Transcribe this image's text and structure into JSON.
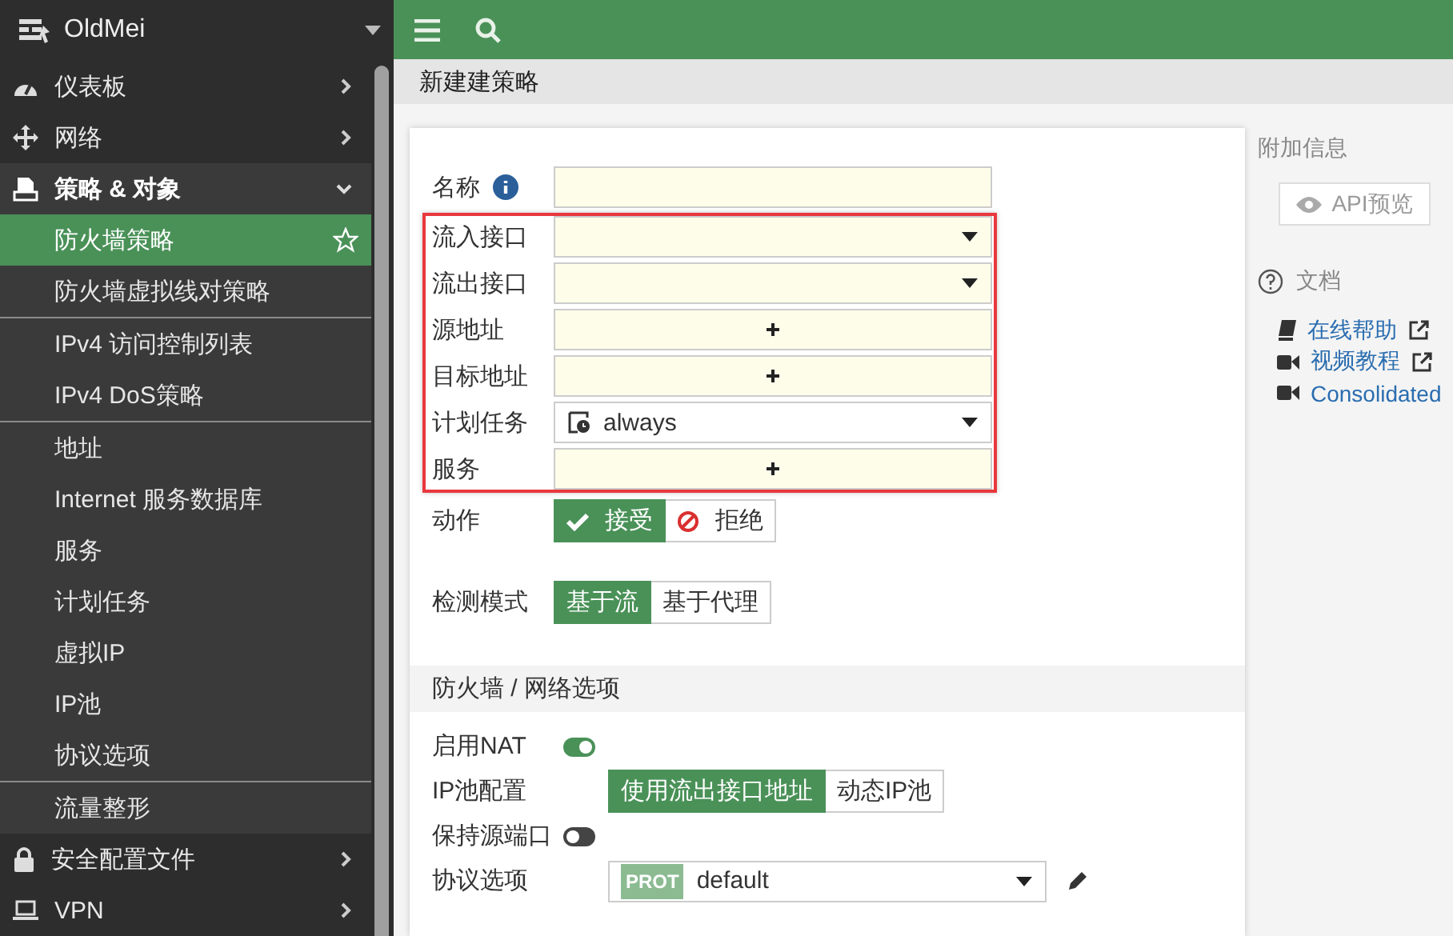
{
  "brand": {
    "name": "OldMei"
  },
  "sidebar": {
    "items": [
      {
        "label": "仪表板",
        "expanded": false
      },
      {
        "label": "网络",
        "expanded": false
      },
      {
        "label": "策略 & 对象",
        "expanded": true,
        "groups": [
          [
            {
              "label": "防火墙策略",
              "selected": true
            },
            {
              "label": "防火墙虚拟线对策略",
              "selected": false
            }
          ],
          [
            {
              "label": "IPv4 访问控制列表",
              "selected": false
            },
            {
              "label": "IPv4 DoS策略",
              "selected": false
            }
          ],
          [
            {
              "label": "地址",
              "selected": false
            },
            {
              "label": "Internet 服务数据库",
              "selected": false
            },
            {
              "label": "服务",
              "selected": false
            },
            {
              "label": "计划任务",
              "selected": false
            },
            {
              "label": "虚拟IP",
              "selected": false
            },
            {
              "label": "IP池",
              "selected": false
            },
            {
              "label": "协议选项",
              "selected": false
            }
          ],
          [
            {
              "label": "流量整形",
              "selected": false
            }
          ]
        ]
      },
      {
        "label": "安全配置文件",
        "expanded": false
      },
      {
        "label": "VPN",
        "expanded": false
      }
    ]
  },
  "breadcrumb": "新建建策略",
  "form": {
    "groups": [
      {
        "highlighted": false,
        "fields": [
          {
            "label": "名称",
            "kind": "text",
            "info": true
          }
        ]
      },
      {
        "highlighted": true,
        "fields": [
          {
            "label": "流入接口",
            "kind": "select",
            "info": false
          },
          {
            "label": "流出接口",
            "kind": "select",
            "info": false
          },
          {
            "label": "源地址",
            "kind": "add",
            "info": false
          },
          {
            "label": "目标地址",
            "kind": "add",
            "info": false
          },
          {
            "label": "计划任务",
            "kind": "schedule",
            "value": "always",
            "info": false
          },
          {
            "label": "服务",
            "kind": "add",
            "info": false
          }
        ]
      }
    ],
    "action": {
      "label": "动作",
      "options": [
        {
          "label": "接受",
          "selected": true
        },
        {
          "label": "拒绝",
          "selected": false
        }
      ]
    },
    "inspection": {
      "label": "检测模式",
      "options": [
        {
          "label": "基于流",
          "selected": true
        },
        {
          "label": "基于代理",
          "selected": false
        }
      ]
    },
    "section": {
      "title": "防火墙 / 网络选项",
      "rows": [
        {
          "kind": "toggle",
          "label": "启用NAT",
          "on": true
        },
        {
          "kind": "segmented",
          "label": "IP池配置",
          "options": [
            {
              "label": "使用流出接口地址",
              "selected": true
            },
            {
              "label": "动态IP池",
              "selected": false
            }
          ]
        },
        {
          "kind": "toggle",
          "label": "保持源端口",
          "on": false
        },
        {
          "kind": "select",
          "label": "协议选项",
          "badge": "PROT",
          "value": "default"
        }
      ]
    }
  },
  "info": {
    "title": "附加信息",
    "api_button": {
      "label": "API预览",
      "disabled": true
    },
    "docs": {
      "title": "文档",
      "links": [
        {
          "label": "在线帮助",
          "external": true
        },
        {
          "label": "视频教程",
          "external": true
        },
        {
          "label": "Consolidated",
          "external": false
        }
      ]
    }
  }
}
